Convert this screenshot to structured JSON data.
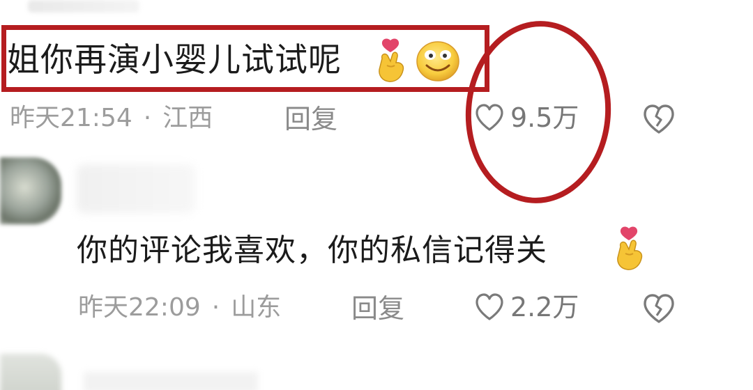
{
  "comments": [
    {
      "text": "姐你再演小婴儿试试呢",
      "time": "昨天21:54",
      "separator": "·",
      "location": "江西",
      "reply_label": "回复",
      "likes": "9.5万"
    },
    {
      "text": "你的评论我喜欢，你的私信记得关",
      "time": "昨天22:09",
      "separator": "·",
      "location": "山东",
      "reply_label": "回复",
      "likes": "2.2万"
    }
  ],
  "annotation": {
    "color": "#b51d20"
  },
  "icons": {
    "like": "heart-outline-icon",
    "dislike": "broken-heart-icon",
    "emoji_1": "finger-heart-emoji",
    "emoji_2": "smiley-emoji"
  }
}
